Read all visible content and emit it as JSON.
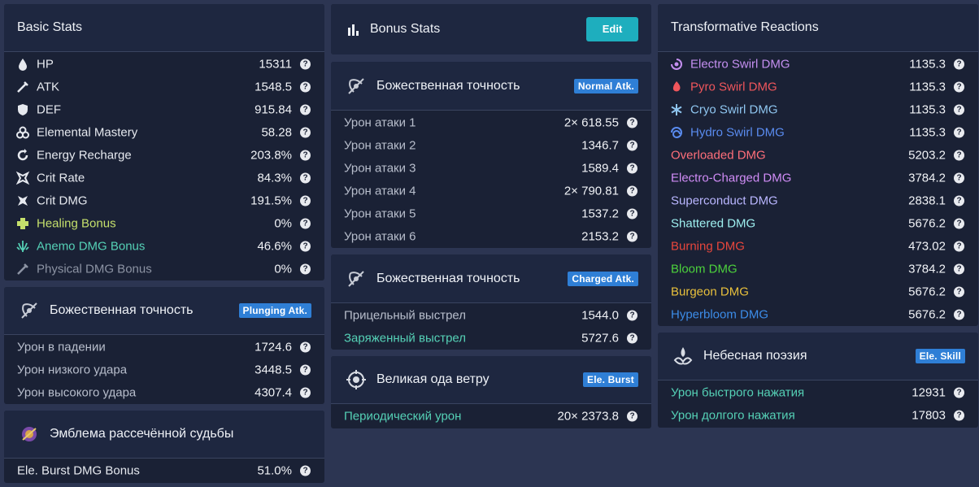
{
  "basic": {
    "title": "Basic Stats",
    "rows": [
      {
        "label": "HP",
        "value": "15311",
        "color": "#e6e9ef"
      },
      {
        "label": "ATK",
        "value": "1548.5",
        "color": "#e6e9ef"
      },
      {
        "label": "DEF",
        "value": "915.84",
        "color": "#e6e9ef"
      },
      {
        "label": "Elemental Mastery",
        "value": "58.28",
        "color": "#e6e9ef"
      },
      {
        "label": "Energy Recharge",
        "value": "203.8%",
        "color": "#e6e9ef"
      },
      {
        "label": "Crit Rate",
        "value": "84.3%",
        "color": "#e6e9ef"
      },
      {
        "label": "Crit DMG",
        "value": "191.5%",
        "color": "#e6e9ef"
      },
      {
        "label": "Healing Bonus",
        "value": "0%",
        "color": "#c5e06c"
      },
      {
        "label": "Anemo DMG Bonus",
        "value": "46.6%",
        "color": "#55d1b6"
      },
      {
        "label": "Physical DMG Bonus",
        "value": "0%",
        "color": "#8c93a3"
      }
    ],
    "icons": [
      "hp-icon",
      "atk-icon",
      "def-icon",
      "elemental-mastery-icon",
      "energy-recharge-icon",
      "crit-rate-icon",
      "crit-dmg-icon",
      "healing-bonus-icon",
      "anemo-dmg-icon",
      "physical-dmg-icon"
    ]
  },
  "plunging": {
    "title": "Божественная точность",
    "tag": "Plunging Atk.",
    "rows": [
      {
        "label": "Урон в падении",
        "value": "1724.6"
      },
      {
        "label": "Урон низкого удара",
        "value": "3448.5"
      },
      {
        "label": "Урон высокого удара",
        "value": "4307.4"
      }
    ]
  },
  "emblem": {
    "title": "Эмблема рассечённой судьбы",
    "rows": [
      {
        "label": "Ele. Burst DMG Bonus",
        "value": "51.0%"
      }
    ]
  },
  "bonus": {
    "title": "Bonus Stats",
    "edit_label": "Edit"
  },
  "normal": {
    "title": "Божественная точность",
    "tag": "Normal Atk.",
    "rows": [
      {
        "label": "Урон атаки 1",
        "value": "2× 618.55"
      },
      {
        "label": "Урон атаки 2",
        "value": "1346.7"
      },
      {
        "label": "Урон атаки 3",
        "value": "1589.4"
      },
      {
        "label": "Урон атаки 4",
        "value": "2× 790.81"
      },
      {
        "label": "Урон атаки 5",
        "value": "1537.2"
      },
      {
        "label": "Урон атаки 6",
        "value": "2153.2"
      }
    ]
  },
  "charged": {
    "title": "Божественная точность",
    "tag": "Charged Atk.",
    "rows": [
      {
        "label": "Прицельный выстрел",
        "value": "1544.0",
        "color": "#b8becc"
      },
      {
        "label": "Заряженный выстрел",
        "value": "5727.6",
        "color": "#55d1b6"
      }
    ]
  },
  "burst": {
    "title": "Великая ода ветру",
    "tag": "Ele. Burst",
    "rows": [
      {
        "label": "Периодический урон",
        "value": "20× 2373.8",
        "color": "#55d1b6"
      }
    ]
  },
  "transform": {
    "title": "Transformative Reactions",
    "rows": [
      {
        "label": "Electro Swirl DMG",
        "value": "1135.3",
        "color": "#c48ff0",
        "icon": "electro-swirl-icon"
      },
      {
        "label": "Pyro Swirl DMG",
        "value": "1135.3",
        "color": "#f0565c",
        "icon": "pyro-swirl-icon"
      },
      {
        "label": "Cryo Swirl DMG",
        "value": "1135.3",
        "color": "#8fc6f0",
        "icon": "cryo-swirl-icon"
      },
      {
        "label": "Hydro Swirl DMG",
        "value": "1135.3",
        "color": "#5a8cf0",
        "icon": "hydro-swirl-icon"
      },
      {
        "label": "Overloaded DMG",
        "value": "5203.2",
        "color": "#ff6f7a"
      },
      {
        "label": "Electro-Charged DMG",
        "value": "3784.2",
        "color": "#d08cf6"
      },
      {
        "label": "Superconduct DMG",
        "value": "2838.1",
        "color": "#b9b6ff"
      },
      {
        "label": "Shattered DMG",
        "value": "5676.2",
        "color": "#9ef0f0"
      },
      {
        "label": "Burning DMG",
        "value": "473.02",
        "color": "#e8463c"
      },
      {
        "label": "Bloom DMG",
        "value": "3784.2",
        "color": "#4cd13c"
      },
      {
        "label": "Burgeon DMG",
        "value": "5676.2",
        "color": "#e8c03c"
      },
      {
        "label": "Hyperbloom DMG",
        "value": "5676.2",
        "color": "#3c8ce8"
      }
    ]
  },
  "skill": {
    "title": "Небесная поэзия",
    "tag": "Ele. Skill",
    "rows": [
      {
        "label": "Урон быстрого нажатия",
        "value": "12931",
        "color": "#55d1b6"
      },
      {
        "label": "Урон долгого нажатия",
        "value": "17803",
        "color": "#55d1b6"
      }
    ]
  }
}
